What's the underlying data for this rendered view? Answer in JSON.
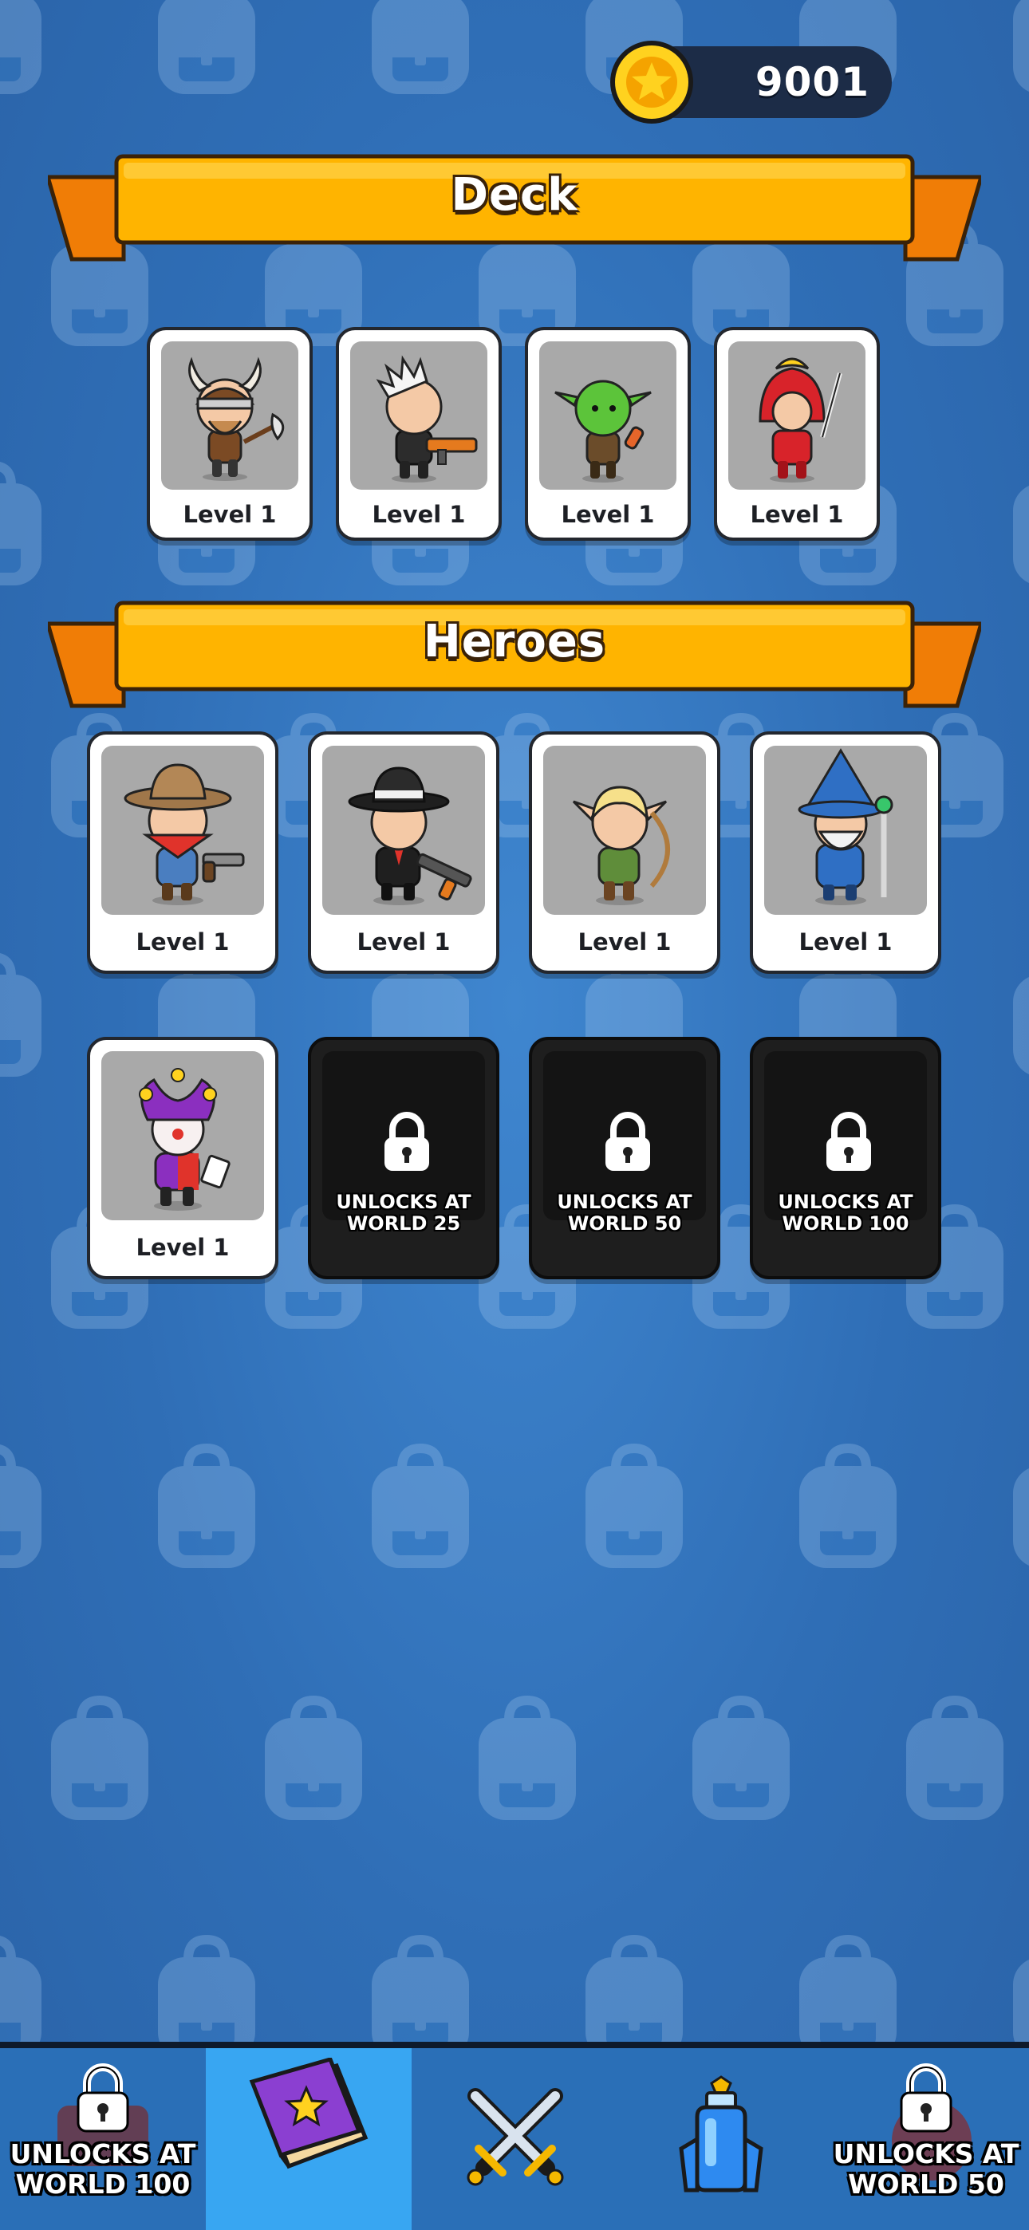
{
  "coins": {
    "value": "9001",
    "icon": "star-coin-icon"
  },
  "deck": {
    "title": "Deck",
    "cards": [
      {
        "hero": "viking",
        "level": "Level 1"
      },
      {
        "hero": "mohawk-gunner",
        "level": "Level 1"
      },
      {
        "hero": "goblin",
        "level": "Level 1"
      },
      {
        "hero": "samurai",
        "level": "Level 1"
      }
    ]
  },
  "heroes": {
    "title": "Heroes",
    "cards": [
      {
        "hero": "cowboy",
        "level": "Level 1",
        "locked": false
      },
      {
        "hero": "mobster",
        "level": "Level 1",
        "locked": false
      },
      {
        "hero": "elf-archer",
        "level": "Level 1",
        "locked": false
      },
      {
        "hero": "wizard",
        "level": "Level 1",
        "locked": false
      },
      {
        "hero": "jester",
        "level": "Level 1",
        "locked": false
      },
      {
        "hero": "locked",
        "unlock_text": "UNLOCKS AT WORLD 25",
        "locked": true
      },
      {
        "hero": "locked",
        "unlock_text": "UNLOCKS AT WORLD 50",
        "locked": true
      },
      {
        "hero": "locked",
        "unlock_text": "UNLOCKS AT WORLD 100",
        "locked": true
      }
    ]
  },
  "nav": {
    "items": [
      {
        "icon": "shop-icon",
        "locked": true,
        "label": "UNLOCKS AT WORLD 100"
      },
      {
        "icon": "book-icon",
        "locked": false,
        "active": true
      },
      {
        "icon": "crossed-swords-icon",
        "locked": false
      },
      {
        "icon": "potion-icon",
        "locked": false
      },
      {
        "icon": "skull-icon",
        "locked": true,
        "label": "UNLOCKS AT WORLD 50"
      }
    ]
  },
  "colors": {
    "background": "#3a7bc4",
    "banner": "#ffb400",
    "nav_active": "#38a6f2",
    "card_portrait": "#a9a9a9"
  }
}
